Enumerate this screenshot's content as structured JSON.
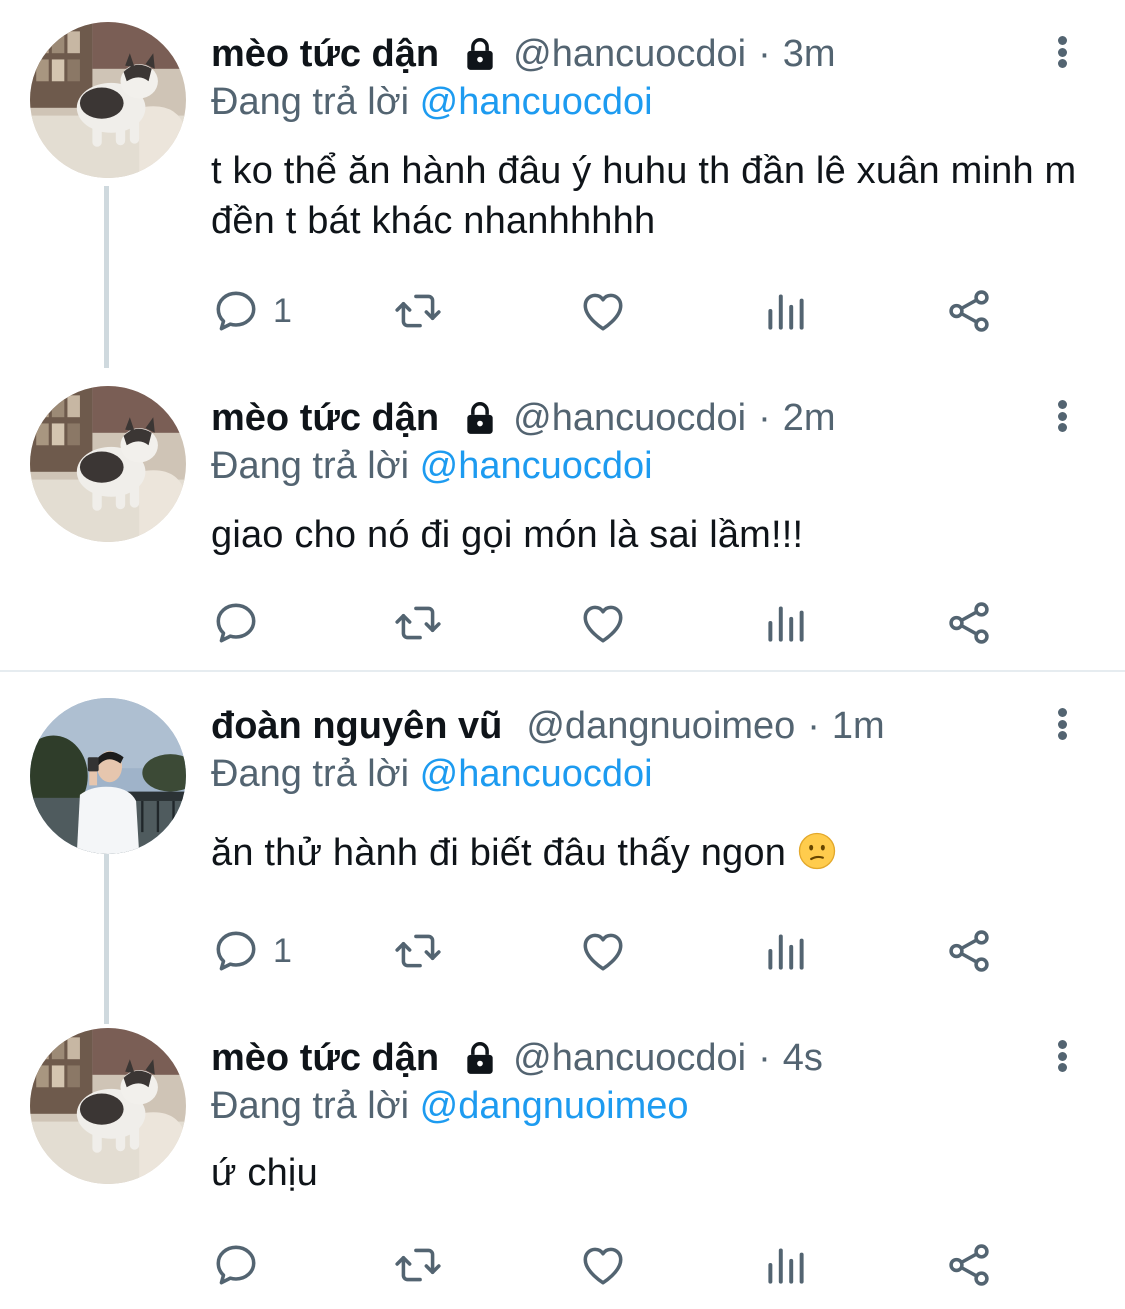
{
  "tweets": [
    {
      "name": "mèo tức dận",
      "locked": true,
      "handle": "@hancuocdoi",
      "separator": "·",
      "time": "3m",
      "reply_prefix": "Đang trả lời",
      "reply_to": "@hancuocdoi",
      "text": "t ko thể ăn hành đâu ý huhu th đần lê xuân minh m đền t bát khác nhanhhhhh",
      "reply_count": "1"
    },
    {
      "name": "mèo tức dận",
      "locked": true,
      "handle": "@hancuocdoi",
      "separator": "·",
      "time": "2m",
      "reply_prefix": "Đang trả lời",
      "reply_to": "@hancuocdoi",
      "text": "giao cho nó đi gọi món là sai lầm!!!",
      "reply_count": ""
    },
    {
      "name": "đoàn nguyên vũ",
      "locked": false,
      "handle": "@dangnuoimeo",
      "separator": "·",
      "time": "1m",
      "reply_prefix": "Đang trả lời",
      "reply_to": "@hancuocdoi",
      "text": "ăn thử hành đi biết đâu thấy ngon",
      "emoji": "confused-face",
      "reply_count": "1"
    },
    {
      "name": "mèo tức dận",
      "locked": true,
      "handle": "@hancuocdoi",
      "separator": "·",
      "time": "4s",
      "reply_prefix": "Đang trả lời",
      "reply_to": "@dangnuoimeo",
      "text": "ứ chịu",
      "reply_count": ""
    }
  ],
  "icons": {
    "reply": "reply-bubble-icon",
    "retweet": "retweet-icon",
    "like": "heart-icon",
    "views": "analytics-icon",
    "share": "share-icon",
    "more": "more-vertical-icon",
    "lock": "lock-icon"
  },
  "colors": {
    "text": "#0f1419",
    "secondary": "#536471",
    "accent": "#1d9bf0",
    "thread_line": "#cfd9de",
    "divider": "#e6ecf0"
  }
}
